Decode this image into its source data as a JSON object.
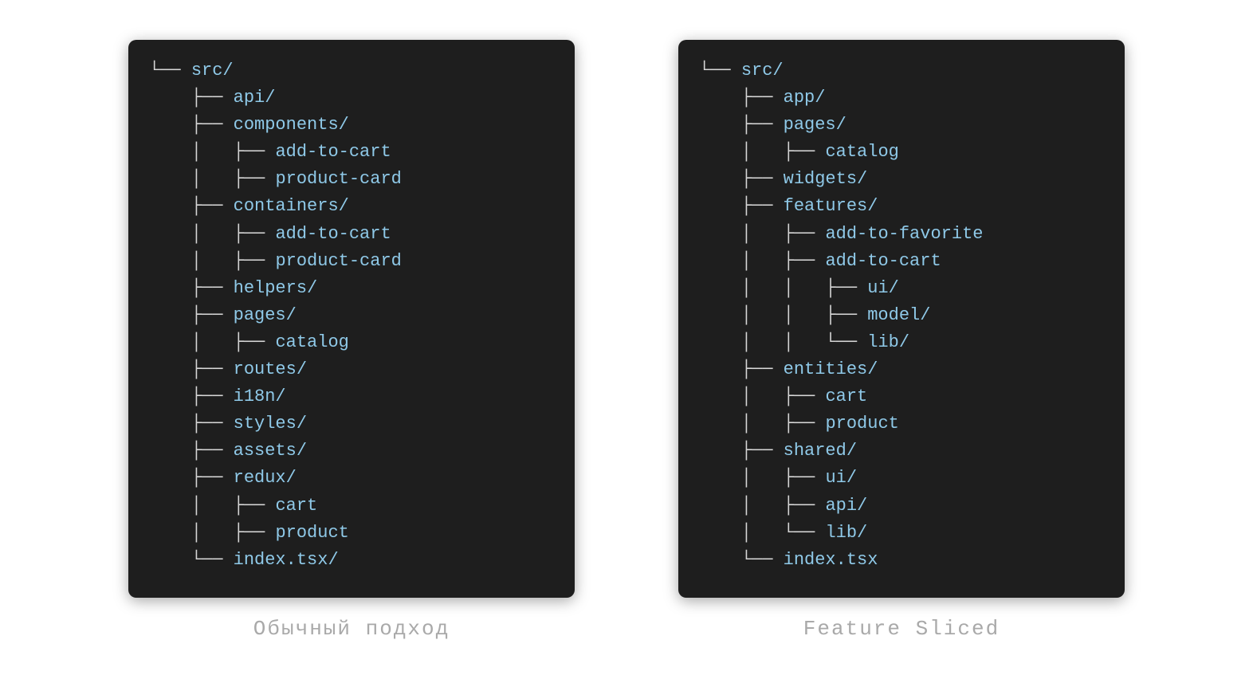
{
  "left": {
    "caption": "Обычный подход",
    "lines": [
      {
        "prefix": "└── ",
        "name": "src/"
      },
      {
        "prefix": "    ├── ",
        "name": "api/"
      },
      {
        "prefix": "    ├── ",
        "name": "components/"
      },
      {
        "prefix": "    │   ├── ",
        "name": "add-to-cart"
      },
      {
        "prefix": "    │   ├── ",
        "name": "product-card"
      },
      {
        "prefix": "    ├── ",
        "name": "containers/"
      },
      {
        "prefix": "    │   ├── ",
        "name": "add-to-cart"
      },
      {
        "prefix": "    │   ├── ",
        "name": "product-card"
      },
      {
        "prefix": "    ├── ",
        "name": "helpers/"
      },
      {
        "prefix": "    ├── ",
        "name": "pages/"
      },
      {
        "prefix": "    │   ├── ",
        "name": "catalog"
      },
      {
        "prefix": "    ├── ",
        "name": "routes/"
      },
      {
        "prefix": "    ├── ",
        "name": "i18n/"
      },
      {
        "prefix": "    ├── ",
        "name": "styles/"
      },
      {
        "prefix": "    ├── ",
        "name": "assets/"
      },
      {
        "prefix": "    ├── ",
        "name": "redux/"
      },
      {
        "prefix": "    │   ├── ",
        "name": "cart"
      },
      {
        "prefix": "    │   ├── ",
        "name": "product"
      },
      {
        "prefix": "    └── ",
        "name": "index.tsx/"
      }
    ]
  },
  "right": {
    "caption": "Feature Sliced",
    "lines": [
      {
        "prefix": "└── ",
        "name": "src/"
      },
      {
        "prefix": "    ├── ",
        "name": "app/"
      },
      {
        "prefix": "    ├── ",
        "name": "pages/"
      },
      {
        "prefix": "    │   ├── ",
        "name": "catalog"
      },
      {
        "prefix": "    ├── ",
        "name": "widgets/"
      },
      {
        "prefix": "    ├── ",
        "name": "features/"
      },
      {
        "prefix": "    │   ├── ",
        "name": "add-to-favorite"
      },
      {
        "prefix": "    │   ├── ",
        "name": "add-to-cart"
      },
      {
        "prefix": "    │   │   ├── ",
        "name": "ui/"
      },
      {
        "prefix": "    │   │   ├── ",
        "name": "model/"
      },
      {
        "prefix": "    │   │   └── ",
        "name": "lib/"
      },
      {
        "prefix": "    ├── ",
        "name": "entities/"
      },
      {
        "prefix": "    │   ├── ",
        "name": "cart"
      },
      {
        "prefix": "    │   ├── ",
        "name": "product"
      },
      {
        "prefix": "    ├── ",
        "name": "shared/"
      },
      {
        "prefix": "    │   ├── ",
        "name": "ui/"
      },
      {
        "prefix": "    │   ├── ",
        "name": "api/"
      },
      {
        "prefix": "    │   └── ",
        "name": "lib/"
      },
      {
        "prefix": "    └── ",
        "name": "index.tsx"
      }
    ]
  }
}
